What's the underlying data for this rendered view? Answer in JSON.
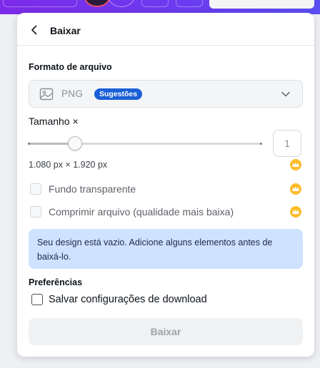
{
  "panel": {
    "title": "Baixar",
    "back_icon": "chevron-left-icon"
  },
  "file_format": {
    "label": "Formato de arquivo",
    "selected": "PNG",
    "badge": "Sugestões",
    "icon": "image-icon"
  },
  "size": {
    "label": "Tamanho ×",
    "multiplier": "1",
    "slider_fraction": 0.2,
    "dimensions": "1.080 px × 1.920 px"
  },
  "options": [
    {
      "label": "Fundo transparente",
      "checked": false,
      "premium": true
    },
    {
      "label": "Comprimir arquivo (qualidade mais baixa)",
      "checked": false,
      "premium": true
    }
  ],
  "info_message": "Seu design está vazio. Adicione alguns elementos antes de baixá-lo.",
  "preferences": {
    "label": "Preferências",
    "save_settings_label": "Salvar configurações de download",
    "save_settings_checked": false
  },
  "download_button": "Baixar",
  "colors": {
    "accent": "#7d2ae8",
    "badge": "#1a5fd6",
    "info_bg": "#cfe2ff",
    "crown": "#fdbc2c"
  }
}
